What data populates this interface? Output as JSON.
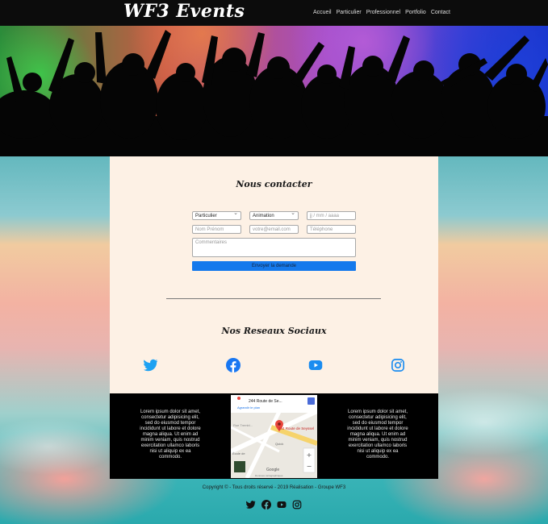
{
  "header": {
    "brand": "WF3 Events",
    "nav": [
      "Accueil",
      "Particulier",
      "Professionnel",
      "Portfolio",
      "Contact"
    ]
  },
  "contact": {
    "title": "Nous contacter",
    "type_select": "Particulier",
    "event_select": "Animation",
    "date_placeholder": "jj / mm / aaaa",
    "name_placeholder": "Nom Prénom",
    "email_placeholder": "votre@email.com",
    "phone_placeholder": "Téléphone",
    "comments_placeholder": "Commentaires",
    "submit_label": "Envoyer la demande"
  },
  "social": {
    "title": "Nos Reseaux Sociaux",
    "icons": [
      "twitter-icon",
      "facebook-icon",
      "youtube-icon",
      "instagram-icon"
    ]
  },
  "footer": {
    "lorem_left": "Lorem ipsum dolor sit amet, consectetur adipisicing elit, sed do eiusmod tempor incididunt ut labore et dolore magna aliqua. Ut enim ad minim veniam, quis nostrud exercitation ullamco laboris nisi ut aliquip ex ea commodo.",
    "lorem_right": "Lorem ipsum dolor sit amet, consectetur adipisicing elit, sed do eiusmod tempor incididunt ut labore et dolore magna aliqua. Ut enim ad minim veniam, quis nostrud exercitation ullamco laboris nisi ut aliquip ex ea commodo.",
    "map": {
      "address_short": "244 Route de Se...",
      "directions_link": "Agrandir le plan",
      "pin_label": "244 Route de Seyssel",
      "place_label": "Quick",
      "school_label": "École de",
      "street_label": "Rue Trembl...",
      "brand": "Google",
      "bottom_text": "Données cartographiques"
    },
    "copyright": "Copyright © - Tous droits réservé - 2019 Réalisation - Groupe WF3"
  },
  "colors": {
    "accent": "#1479ec",
    "panel": "#fdf1e5",
    "twitter": "#1da1f2",
    "facebook": "#1877f2"
  }
}
